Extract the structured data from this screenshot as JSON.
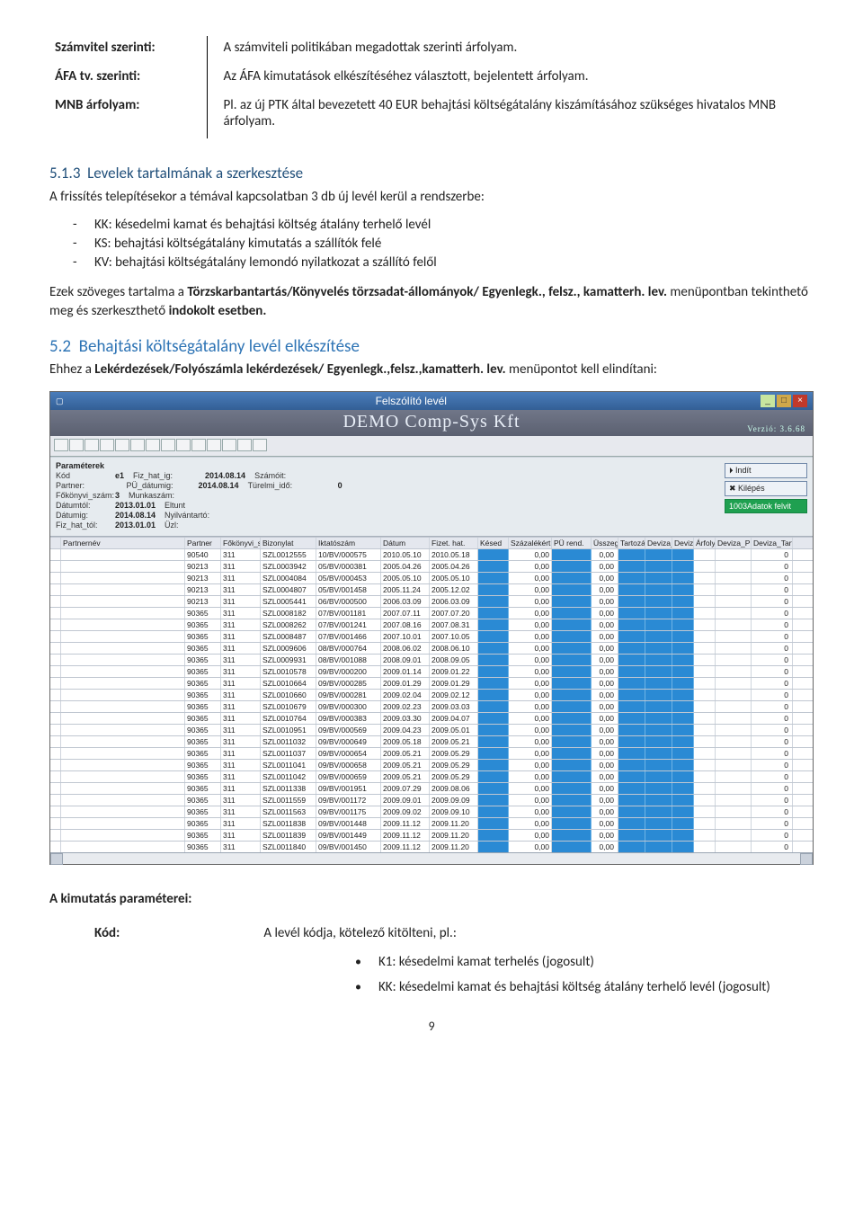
{
  "definitions": [
    {
      "label": "Számvitel szerinti:",
      "desc": "A számviteli politikában megadottak szerinti árfolyam."
    },
    {
      "label": "ÁFA tv. szerinti:",
      "desc": "Az ÁFA kimutatások elkészítéséhez választott, bejelentett árfolyam."
    },
    {
      "label": "MNB árfolyam:",
      "desc": "Pl. az új PTK által bevezetett 40 EUR behajtási költségátalány kiszámításához szükséges hivatalos MNB árfolyam."
    }
  ],
  "section513": {
    "num": "5.1.3",
    "title": "Levelek tartalmának a szerkesztése",
    "intro": "A frissítés telepítésekor a témával kapcsolatban 3 db új levél kerül a rendszerbe:",
    "bullets": [
      "KK: késedelmi kamat és behajtási költség átalány terhelő levél",
      "KS: behajtási költségátalány kimutatás a szállítók felé",
      "KV: behajtási költségátalány lemondó nyilatkozat a szállító felől"
    ],
    "para1a": "Ezek szöveges tartalma a ",
    "para1b": "Törzskarbantartás/Könyvelés törzsadat-állományok/ Egyenlegk., felsz., kamatterh. lev.",
    "para1c": " menüpontban tekinthető meg és szerkeszthető ",
    "para1d": "indokolt esetben."
  },
  "section52": {
    "num": "5.2",
    "title": "Behajtási költségátalány levél elkészítése",
    "para_a": "Ehhez a ",
    "para_b": "Lekérdezések/Folyószámla lekérdezések/ Egyenlegk.,felsz.,kamatterh. lev.",
    "para_c": " menüpontot kell elindítani:"
  },
  "app": {
    "window_title": "Felszólító levél",
    "demo_title": "DEMO Comp-Sys Kft",
    "version": "Verzió: 3.6.68",
    "btn_indit": "Indít",
    "btn_kilepes": "Kilépés",
    "btn_adatok": "1003Adatok felvit",
    "params_header": "Paraméterek",
    "labels": {
      "kod": "Kód",
      "kod_val": "e1",
      "fiz": "Fiz_hat_ig:",
      "fiz_val": "2014.08.14",
      "szamot": "Számóit:",
      "partner": "Partner:",
      "pu": "PÜ_dátumig:",
      "pu_val": "2014.08.14",
      "turelmi": "Türelmi_idő:",
      "turelmi_val": "0",
      "fokonyv": "Főkönyvi_szám:",
      "fok_val": "3",
      "munka": "Munkaszám:",
      "datumtol": "Dátumtól:",
      "dat_val": "2013.01.01",
      "eltunt": "Eltunt",
      "datumig": "Dátumig:",
      "datig_val": "2014.08.14",
      "nyilv": "Nyilvántartó:",
      "fht": "Fiz_hat_tól:",
      "fht_val": "2013.01.01",
      "uzl": "Üzl:"
    },
    "columns": [
      "",
      "Partnernév",
      "Partner",
      "Főkönyvi_szám",
      "Bizonylat",
      "Iktatószám",
      "Dátum",
      "Fizet. hat.",
      "Késed",
      "Százalékért",
      "PÜ rend.",
      "Üsszeg",
      "Tartozás",
      "Deviza_árfol",
      "Deviza",
      "Árfolyam",
      "Deviza_PÜ_rend",
      "Deviza_Tartozás"
    ],
    "rows": [
      {
        "pc": "90540",
        "fk": "311",
        "biz": "SZL0012555",
        "ikt": "10/BV/000575",
        "dat": "2010.05.10",
        "fiz": "2010.05.18",
        "sz": "0,00",
        "u": "0,00",
        "dt": "0"
      },
      {
        "pc": "90213",
        "fk": "311",
        "biz": "SZL0003942",
        "ikt": "05/BV/000381",
        "dat": "2005.04.26",
        "fiz": "2005.04.26",
        "sz": "0,00",
        "u": "0,00",
        "dt": "0"
      },
      {
        "pc": "90213",
        "fk": "311",
        "biz": "SZL0004084",
        "ikt": "05/BV/000453",
        "dat": "2005.05.10",
        "fiz": "2005.05.10",
        "sz": "0,00",
        "u": "0,00",
        "dt": "0"
      },
      {
        "pc": "90213",
        "fk": "311",
        "biz": "SZL0004807",
        "ikt": "05/BV/001458",
        "dat": "2005.11.24",
        "fiz": "2005.12.02",
        "sz": "0,00",
        "u": "0,00",
        "dt": "0"
      },
      {
        "pc": "90213",
        "fk": "311",
        "biz": "SZL0005441",
        "ikt": "06/BV/000500",
        "dat": "2006.03.09",
        "fiz": "2006.03.09",
        "sz": "0,00",
        "u": "0,00",
        "dt": "0"
      },
      {
        "pc": "90365",
        "fk": "311",
        "biz": "SZL0008182",
        "ikt": "07/BV/001181",
        "dat": "2007.07.11",
        "fiz": "2007.07.20",
        "sz": "0,00",
        "u": "0,00",
        "dt": "0"
      },
      {
        "pc": "90365",
        "fk": "311",
        "biz": "SZL0008262",
        "ikt": "07/BV/001241",
        "dat": "2007.08.16",
        "fiz": "2007.08.31",
        "sz": "0,00",
        "u": "0,00",
        "dt": "0"
      },
      {
        "pc": "90365",
        "fk": "311",
        "biz": "SZL0008487",
        "ikt": "07/BV/001466",
        "dat": "2007.10.01",
        "fiz": "2007.10.05",
        "sz": "0,00",
        "u": "0,00",
        "dt": "0"
      },
      {
        "pc": "90365",
        "fk": "311",
        "biz": "SZL0009606",
        "ikt": "08/BV/000764",
        "dat": "2008.06.02",
        "fiz": "2008.06.10",
        "sz": "0,00",
        "u": "0,00",
        "dt": "0"
      },
      {
        "pc": "90365",
        "fk": "311",
        "biz": "SZL0009931",
        "ikt": "08/BV/001088",
        "dat": "2008.09.01",
        "fiz": "2008.09.05",
        "sz": "0,00",
        "u": "0,00",
        "dt": "0"
      },
      {
        "pc": "90365",
        "fk": "311",
        "biz": "SZL0010578",
        "ikt": "09/BV/000200",
        "dat": "2009.01.14",
        "fiz": "2009.01.22",
        "sz": "0,00",
        "u": "0,00",
        "dt": "0"
      },
      {
        "pc": "90365",
        "fk": "311",
        "biz": "SZL0010664",
        "ikt": "09/BV/000285",
        "dat": "2009.01.29",
        "fiz": "2009.01.29",
        "sz": "0,00",
        "u": "0,00",
        "dt": "0"
      },
      {
        "pc": "90365",
        "fk": "311",
        "biz": "SZL0010660",
        "ikt": "09/BV/000281",
        "dat": "2009.02.04",
        "fiz": "2009.02.12",
        "sz": "0,00",
        "u": "0,00",
        "dt": "0"
      },
      {
        "pc": "90365",
        "fk": "311",
        "biz": "SZL0010679",
        "ikt": "09/BV/000300",
        "dat": "2009.02.23",
        "fiz": "2009.03.03",
        "sz": "0,00",
        "u": "0,00",
        "dt": "0"
      },
      {
        "pc": "90365",
        "fk": "311",
        "biz": "SZL0010764",
        "ikt": "09/BV/000383",
        "dat": "2009.03.30",
        "fiz": "2009.04.07",
        "sz": "0,00",
        "u": "0,00",
        "dt": "0"
      },
      {
        "pc": "90365",
        "fk": "311",
        "biz": "SZL0010951",
        "ikt": "09/BV/000569",
        "dat": "2009.04.23",
        "fiz": "2009.05.01",
        "sz": "0,00",
        "u": "0,00",
        "dt": "0"
      },
      {
        "pc": "90365",
        "fk": "311",
        "biz": "SZL0011032",
        "ikt": "09/BV/000649",
        "dat": "2009.05.18",
        "fiz": "2009.05.21",
        "sz": "0,00",
        "u": "0,00",
        "dt": "0"
      },
      {
        "pc": "90365",
        "fk": "311",
        "biz": "SZL0011037",
        "ikt": "09/BV/000654",
        "dat": "2009.05.21",
        "fiz": "2009.05.29",
        "sz": "0,00",
        "u": "0,00",
        "dt": "0"
      },
      {
        "pc": "90365",
        "fk": "311",
        "biz": "SZL0011041",
        "ikt": "09/BV/000658",
        "dat": "2009.05.21",
        "fiz": "2009.05.29",
        "sz": "0,00",
        "u": "0,00",
        "dt": "0"
      },
      {
        "pc": "90365",
        "fk": "311",
        "biz": "SZL0011042",
        "ikt": "09/BV/000659",
        "dat": "2009.05.21",
        "fiz": "2009.05.29",
        "sz": "0,00",
        "u": "0,00",
        "dt": "0"
      },
      {
        "pc": "90365",
        "fk": "311",
        "biz": "SZL0011338",
        "ikt": "09/BV/001951",
        "dat": "2009.07.29",
        "fiz": "2009.08.06",
        "sz": "0,00",
        "u": "0,00",
        "dt": "0"
      },
      {
        "pc": "90365",
        "fk": "311",
        "biz": "SZL0011559",
        "ikt": "09/BV/001172",
        "dat": "2009.09.01",
        "fiz": "2009.09.09",
        "sz": "0,00",
        "u": "0,00",
        "dt": "0"
      },
      {
        "pc": "90365",
        "fk": "311",
        "biz": "SZL0011563",
        "ikt": "09/BV/001175",
        "dat": "2009.09.02",
        "fiz": "2009.09.10",
        "sz": "0,00",
        "u": "0,00",
        "dt": "0"
      },
      {
        "pc": "90365",
        "fk": "311",
        "biz": "SZL0011838",
        "ikt": "09/BV/001448",
        "dat": "2009.11.12",
        "fiz": "2009.11.20",
        "sz": "0,00",
        "u": "0,00",
        "dt": "0"
      },
      {
        "pc": "90365",
        "fk": "311",
        "biz": "SZL0011839",
        "ikt": "09/BV/001449",
        "dat": "2009.11.12",
        "fiz": "2009.11.20",
        "sz": "0,00",
        "u": "0,00",
        "dt": "0"
      },
      {
        "pc": "90365",
        "fk": "311",
        "biz": "SZL0011840",
        "ikt": "09/BV/001450",
        "dat": "2009.11.12",
        "fiz": "2009.11.20",
        "sz": "0,00",
        "u": "0,00",
        "dt": "0"
      }
    ]
  },
  "params_section": {
    "title": "A kimutatás paraméterei:",
    "kod_label": "Kód:",
    "kod_desc": "A levél kódja, kötelező kitölteni, pl.:",
    "kod_bullets": [
      "K1: késedelmi kamat terhelés (jogosult)",
      "KK: késedelmi kamat és behajtási költség átalány terhelő levél (jogosult)"
    ]
  },
  "page_num": "9"
}
